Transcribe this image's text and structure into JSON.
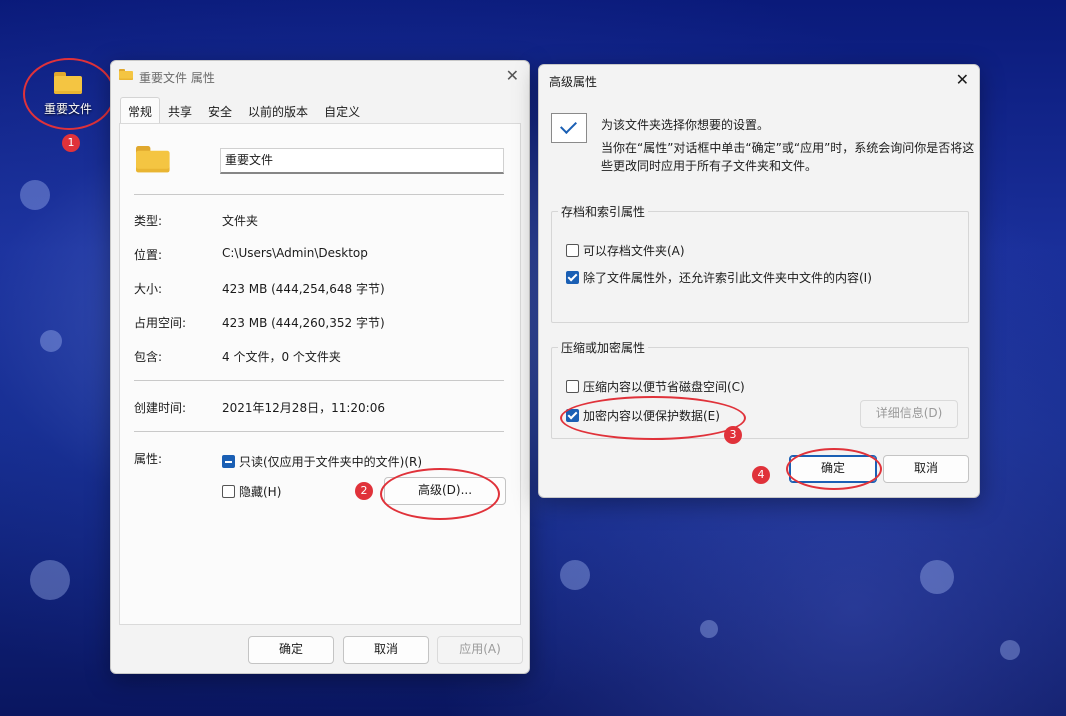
{
  "desktop": {
    "folder_label": "重要文件"
  },
  "badges": [
    "1",
    "2",
    "3",
    "4"
  ],
  "props": {
    "title": "重要文件 属性",
    "tabs": [
      "常规",
      "共享",
      "安全",
      "以前的版本",
      "自定义"
    ],
    "name_value": "重要文件",
    "rows": [
      {
        "k": "类型:",
        "v": "文件夹"
      },
      {
        "k": "位置:",
        "v": "C:\\Users\\Admin\\Desktop"
      },
      {
        "k": "大小:",
        "v": "423 MB (444,254,648 字节)"
      },
      {
        "k": "占用空间:",
        "v": "423 MB (444,260,352 字节)"
      },
      {
        "k": "包含:",
        "v": "4 个文件，0 个文件夹"
      }
    ],
    "created_k": "创建时间:",
    "created_v": "2021年12月28日，11:20:06",
    "attr_k": "属性:",
    "readonly_label": "只读(仅应用于文件夹中的文件)(R)",
    "hidden_label": "隐藏(H)",
    "advanced_btn": "高级(D)...",
    "ok": "确定",
    "cancel": "取消",
    "apply": "应用(A)"
  },
  "adv": {
    "title": "高级属性",
    "intro1": "为该文件夹选择你想要的设置。",
    "intro2": "当你在“属性”对话框中单击“确定”或“应用”时，系统会询问你是否将这",
    "intro3": "些更改同时应用于所有子文件夹和文件。",
    "group1": "存档和索引属性",
    "archive_label": "可以存档文件夹(A)",
    "index_label": "除了文件属性外，还允许索引此文件夹中文件的内容(I)",
    "group2": "压缩或加密属性",
    "compress_label": "压缩内容以便节省磁盘空间(C)",
    "encrypt_label": "加密内容以便保护数据(E)",
    "details_btn": "详细信息(D)",
    "ok": "确定",
    "cancel": "取消"
  },
  "colors": {
    "accent": "#1a5fb4",
    "annotation": "#e0323a"
  }
}
